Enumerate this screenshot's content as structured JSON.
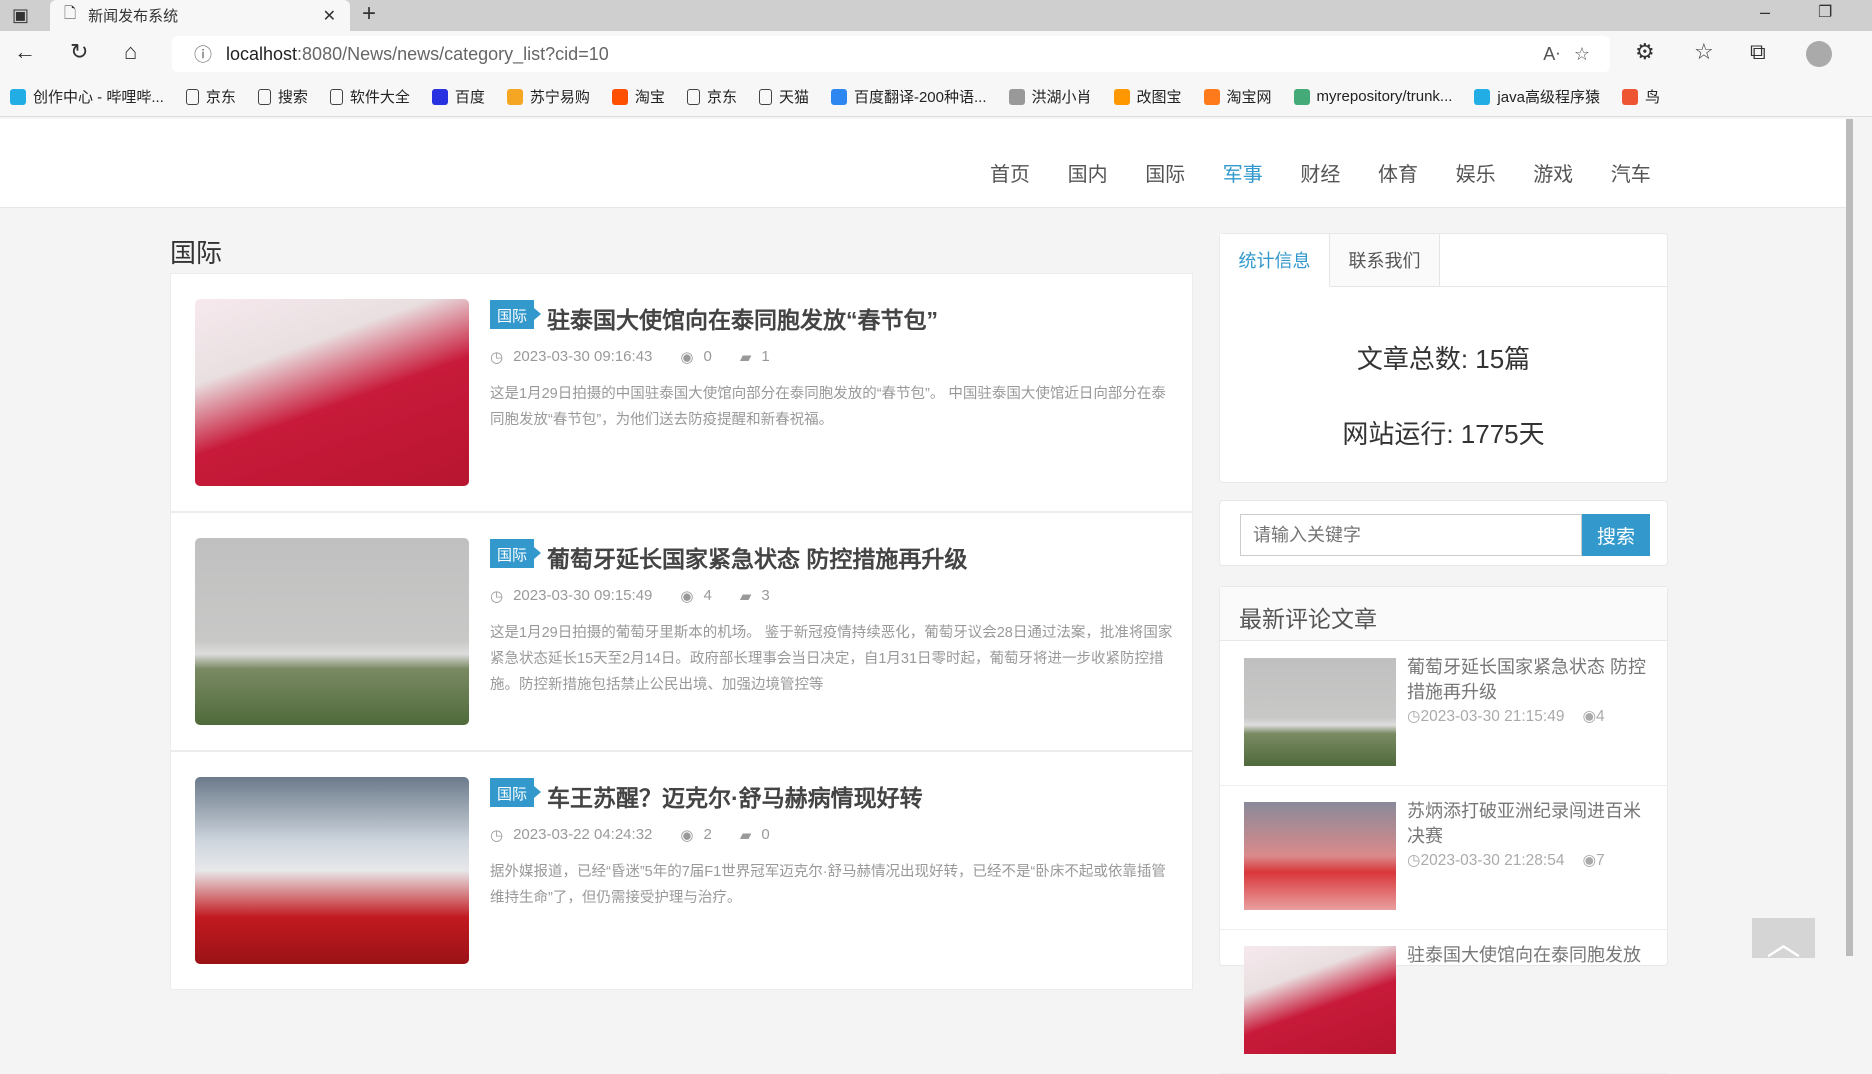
{
  "browser": {
    "tab_title": "新闻发布系统",
    "url_host": "localhost",
    "url_path": ":8080/News/news/category_list?cid=10"
  },
  "bookmarks": [
    {
      "label": "创作中心 - 哔哩哔...",
      "color": "#23ade5"
    },
    {
      "label": "京东",
      "color": ""
    },
    {
      "label": "搜索",
      "color": ""
    },
    {
      "label": "软件大全",
      "color": ""
    },
    {
      "label": "百度",
      "color": "#2932e1"
    },
    {
      "label": "苏宁易购",
      "color": "#f5a623"
    },
    {
      "label": "淘宝",
      "color": "#ff5000"
    },
    {
      "label": "京东",
      "color": ""
    },
    {
      "label": "天猫",
      "color": ""
    },
    {
      "label": "百度翻译-200种语...",
      "color": "#2e87f0"
    },
    {
      "label": "洪湖小肖",
      "color": "#999"
    },
    {
      "label": "改图宝",
      "color": "#ff9800"
    },
    {
      "label": "淘宝网",
      "color": "#ff7a1a"
    },
    {
      "label": "myrepository/trunk...",
      "color": "#4a7"
    },
    {
      "label": "java高级程序猿",
      "color": "#23ade5"
    },
    {
      "label": "鸟",
      "color": "#e53"
    }
  ],
  "nav": [
    "首页",
    "国内",
    "国际",
    "军事",
    "财经",
    "体育",
    "娱乐",
    "游戏",
    "汽车"
  ],
  "category_title": "国际",
  "articles": [
    {
      "badge": "国际",
      "title": "驻泰国大使馆向在泰同胞发放“春节包”",
      "time": "2023-03-30 09:16:43",
      "views": "0",
      "comments": "1",
      "desc": "这是1月29日拍摄的中国驻泰国大使馆向部分在泰同胞发放的“春节包”。 中国驻泰国大使馆近日向部分在泰同胞发放“春节包”，为他们送去防疫提醒和新春祝福。"
    },
    {
      "badge": "国际",
      "title": "葡萄牙延长国家紧急状态 防控措施再升级",
      "time": "2023-03-30 09:15:49",
      "views": "4",
      "comments": "3",
      "desc": "这是1月29日拍摄的葡萄牙里斯本的机场。 鉴于新冠疫情持续恶化，葡萄牙议会28日通过法案，批准将国家紧急状态延长15天至2月14日。政府部长理事会当日决定，自1月31日零时起，葡萄牙将进一步收紧防控措施。防控新措施包括禁止公民出境、加强边境管控等"
    },
    {
      "badge": "国际",
      "title": "车王苏醒？迈克尔·舒马赫病情现好转",
      "time": "2023-03-22 04:24:32",
      "views": "2",
      "comments": "0",
      "desc": "据外媒报道，已经“昏迷”5年的7届F1世界冠军迈克尔·舒马赫情况出现好转，已经不是“卧床不起或依靠插管维持生命”了，但仍需接受护理与治疗。"
    }
  ],
  "sidebar": {
    "tabs": [
      "统计信息",
      "联系我们"
    ],
    "total_articles": "文章总数: 15篇",
    "uptime": "网站运行: 1775天",
    "search_placeholder": "请输入关键字",
    "search_button": "搜索",
    "latest_title": "最新评论文章",
    "latest": [
      {
        "title": "葡萄牙延长国家紧急状态 防控措施再升级",
        "time": "2023-03-30 21:15:49",
        "views": "4"
      },
      {
        "title": "苏炳添打破亚洲纪录闯进百米决赛",
        "time": "2023-03-30 21:28:54",
        "views": "7"
      },
      {
        "title": "驻泰国大使馆向在泰同胞发放",
        "time": "",
        "views": ""
      }
    ]
  },
  "colors": {
    "accent": "#3399cc"
  }
}
